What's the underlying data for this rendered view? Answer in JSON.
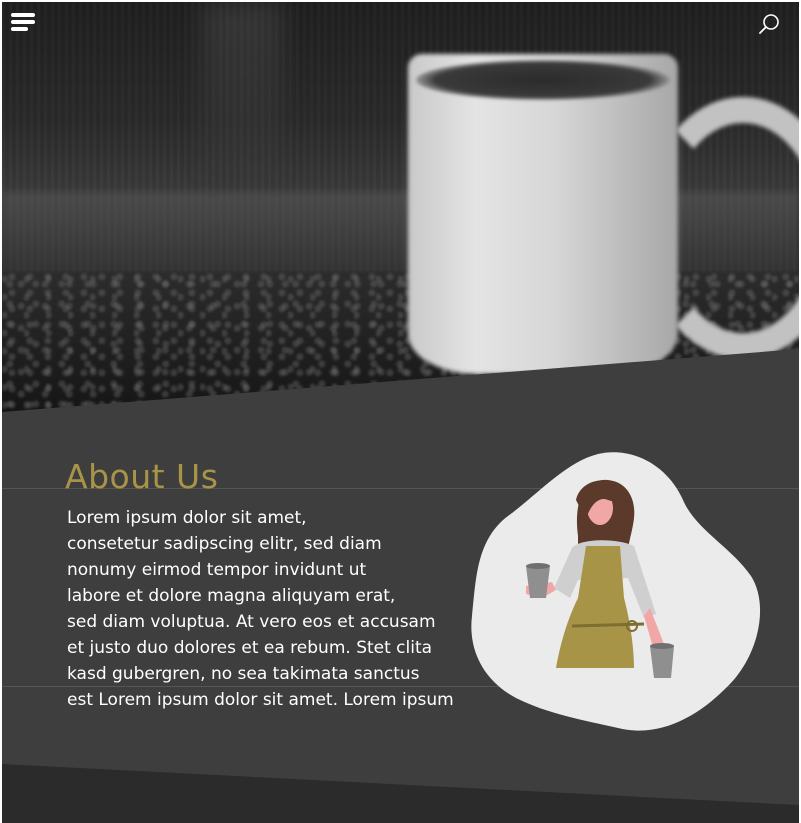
{
  "header": {
    "menu_icon": "hamburger-menu-icon",
    "search_icon": "search-icon"
  },
  "about": {
    "title": "About Us",
    "body_lines": [
      "Lorem ipsum dolor sit amet,",
      "consetetur sadipscing elitr, sed diam",
      "nonumy eirmod tempor invidunt ut",
      "labore et dolore magna aliquyam erat,",
      "sed diam voluptua. At vero eos et accusam",
      "et justo duo dolores et ea rebum. Stet clita",
      "kasd gubergren, no sea takimata sanctus",
      "est Lorem ipsum dolor sit amet. Lorem ipsum"
    ]
  },
  "colors": {
    "accent": "#a89447",
    "panel": "#3e3e3e",
    "text": "#ffffff",
    "blob": "#ebebeb"
  }
}
